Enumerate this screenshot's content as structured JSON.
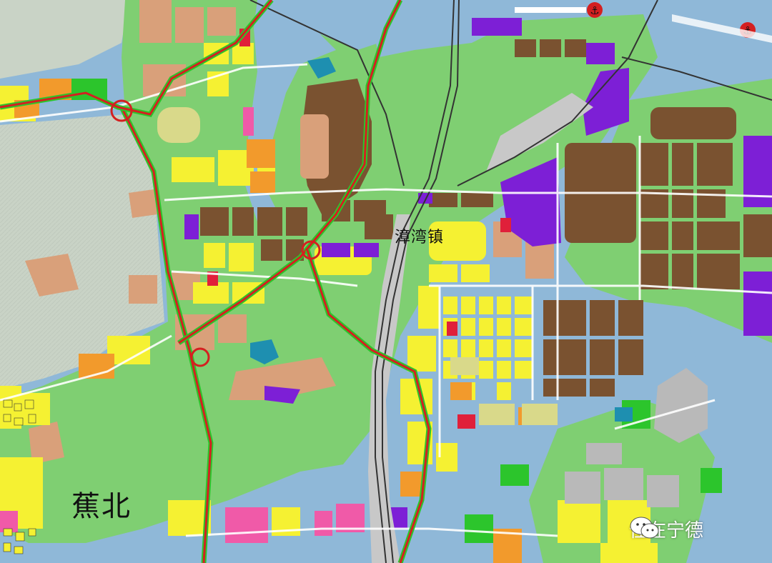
{
  "map": {
    "labels": {
      "town": "漳湾镇",
      "district": "蕉北"
    },
    "watermark": {
      "text": "住在宁德",
      "icon": "wechat-icon"
    },
    "legend_colors": {
      "water": "#8fb8d8",
      "mountain_green": "#7fcf72",
      "hill_relief": "#c9d3c6",
      "industrial": "#7a5230",
      "logistics_purple": "#7d1fd6",
      "residential_yellow": "#f5f132",
      "commercial_orange": "#f29a2c",
      "public_pink": "#f05aa8",
      "education_salmon": "#d9a07a",
      "park_green": "#2cc52c",
      "warehouse_grey": "#b9b9b9",
      "railway_grey": "#c8c8c8",
      "highway_red": "#d42020",
      "port_icon": "anchor-icon"
    }
  }
}
